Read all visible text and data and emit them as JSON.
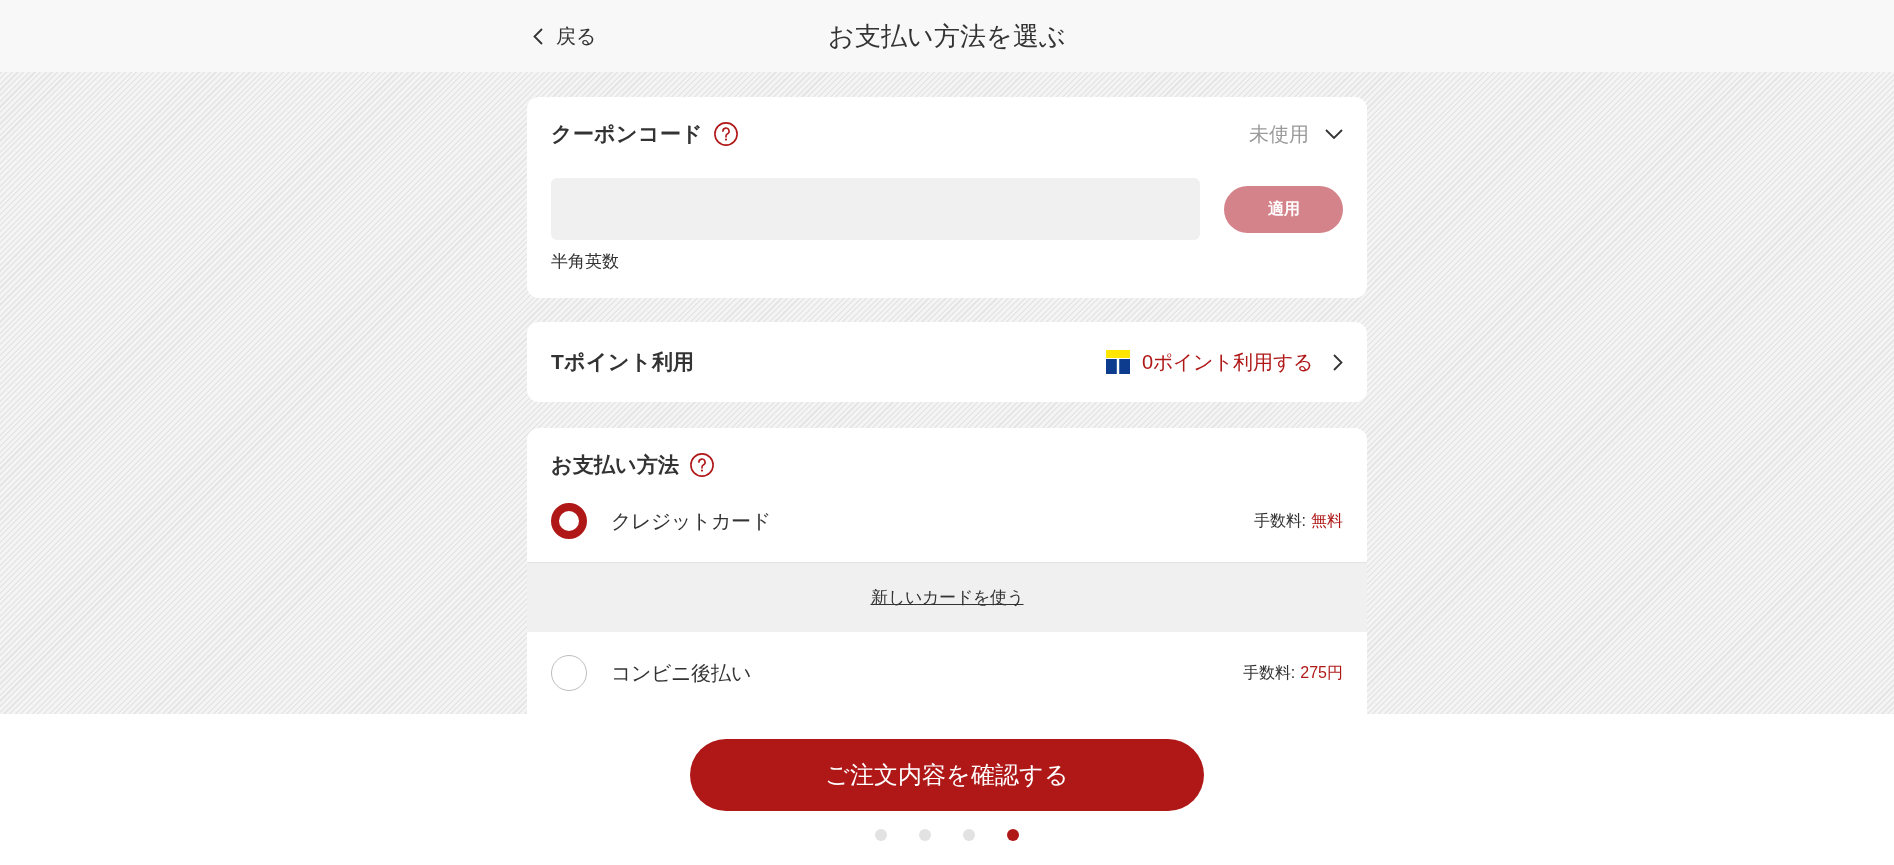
{
  "header": {
    "back_label": "戻る",
    "title": "お支払い方法を選ぶ"
  },
  "coupon": {
    "title": "クーポンコード",
    "status": "未使用",
    "expanded": true,
    "apply_button": {
      "label": "適用",
      "disabled": true
    },
    "hint": "半角英数"
  },
  "points": {
    "title": "Tポイント利用",
    "action": "0ポイント利用する"
  },
  "payment": {
    "title": "お支払い方法",
    "methods": [
      {
        "label": "クレジットカード",
        "selected": true,
        "fee_label": "手数料:",
        "fee": "無料",
        "link": "新しいカードを使う"
      },
      {
        "label": "コンビニ後払い",
        "selected": false,
        "fee_label": "手数料:",
        "fee": "275円"
      }
    ]
  },
  "footer": {
    "confirm_button": "ご注文内容を確認する",
    "steps": [
      {
        "selected": false
      },
      {
        "selected": false
      },
      {
        "selected": false
      },
      {
        "selected": true
      }
    ]
  }
}
